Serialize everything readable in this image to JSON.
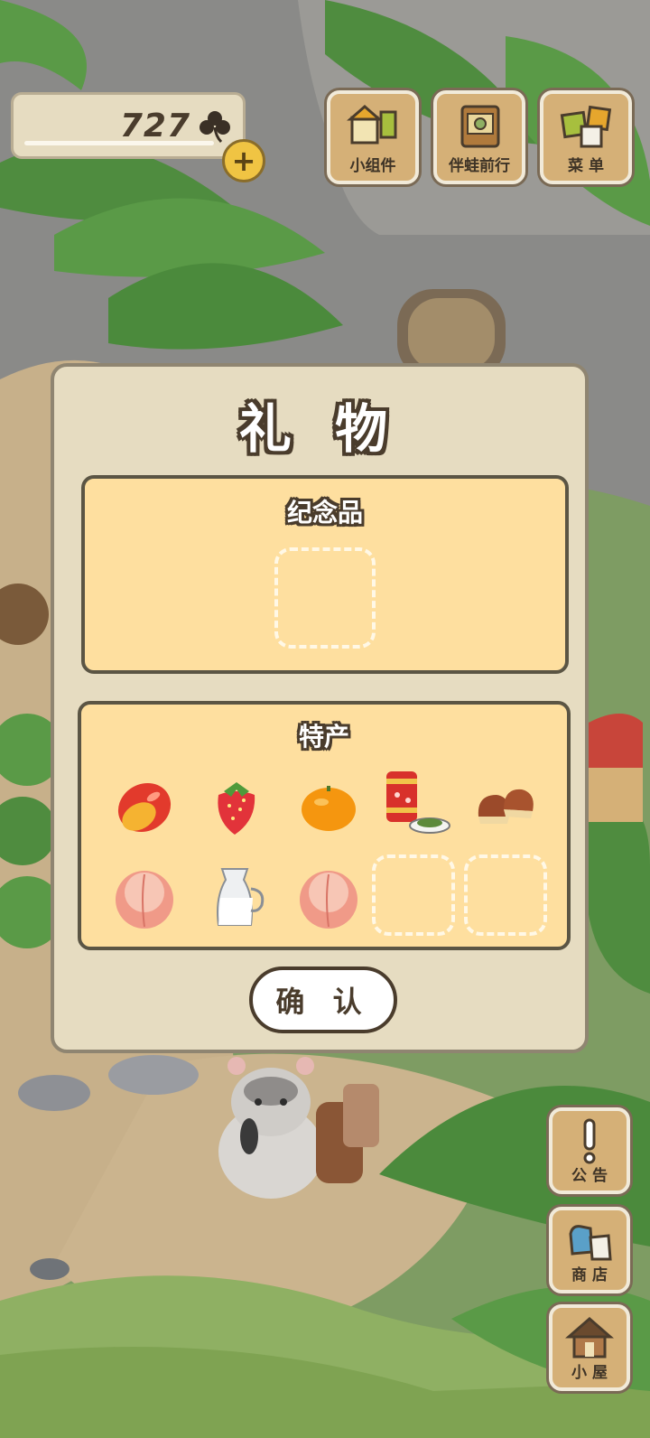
{
  "hud": {
    "clover_count": "727",
    "add_symbol": "+"
  },
  "top_buttons": [
    {
      "label": "小组件",
      "icon": "widget-icon"
    },
    {
      "label": "伴蛙前行",
      "icon": "journey-book-icon"
    },
    {
      "label": "菜 单",
      "icon": "menu-cards-icon"
    }
  ],
  "side_buttons": [
    {
      "label": "公 告",
      "icon": "exclamation-icon"
    },
    {
      "label": "商 店",
      "icon": "shop-bags-icon"
    },
    {
      "label": "小 屋",
      "icon": "house-icon"
    }
  ],
  "dialog": {
    "title": "礼 物",
    "souvenir": {
      "title": "纪念品"
    },
    "specialty": {
      "title": "特产",
      "items": [
        {
          "name": "mango",
          "icon": "mango-icon"
        },
        {
          "name": "strawberry",
          "icon": "strawberry-icon"
        },
        {
          "name": "orange",
          "icon": "orange-icon"
        },
        {
          "name": "tea",
          "icon": "tea-can-icon"
        },
        {
          "name": "chestnut",
          "icon": "chestnut-icon"
        },
        {
          "name": "peach",
          "icon": "peach-icon"
        },
        {
          "name": "milk",
          "icon": "milk-jug-icon"
        },
        {
          "name": "peach",
          "icon": "peach-icon"
        }
      ]
    },
    "confirm_label": "确 认"
  },
  "colors": {
    "dialog_bg": "#e6dcc1",
    "panel_bg": "#fedf9f",
    "outline": "#4a3c2c",
    "button_wood": "#d5b077"
  }
}
